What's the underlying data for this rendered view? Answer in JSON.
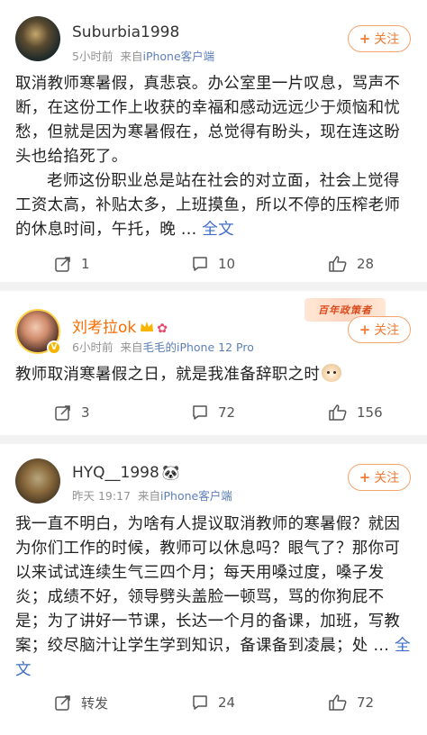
{
  "posts": [
    {
      "username": "Suburbia1998",
      "time": "5小时前",
      "source_prefix": "来自",
      "device": "iPhone客户端",
      "follow_label": "关注",
      "paragraph1": "取消教师寒暑假，真悲哀。办公室里一片叹息，骂声不断，在这份工作上收获的幸福和感动远远少于烦恼和忧愁，但就是因为寒暑假在，总觉得有盼头，现在连这盼头也给掐死了。",
      "paragraph2": "老师这份职业总是站在社会的对立面，社会上觉得工资太高，补贴太多，上班摸鱼，所以不停的压榨老师的休息时间，午托，晚",
      "ellipsis": "...",
      "fulltext_label": "全文",
      "reposts": "1",
      "comments": "10",
      "likes": "28"
    },
    {
      "username": "刘考拉ok",
      "time": "6小时前",
      "source_prefix": "来自",
      "device": "毛毛的iPhone 12 Pro",
      "follow_label": "关注",
      "banner": "百年政策者",
      "text": "教师取消寒暑假之日，就是我准备辞职之时",
      "reposts": "3",
      "comments": "72",
      "likes": "156"
    },
    {
      "username": "HYQ__1998",
      "time": "昨天 19:17",
      "source_prefix": "来自",
      "device": "iPhone客户端",
      "follow_label": "关注",
      "text": "我一直不明白，为啥有人提议取消教师的寒暑假？就因为你们工作的时候，教师可以休息吗？眼气了？那你可以来试试连续生气三四个月；每天用嗓过度，嗓子发炎；成绩不好，领导劈头盖脸一顿骂，骂的你狗屁不是；为了讲好一节课，长达一个月的备课，加班，写教案；绞尽脑汁让学生学到知识，备课备到凌晨；处",
      "ellipsis": "...",
      "fulltext_label": "全文",
      "reposts": "转发",
      "comments": "24",
      "likes": "72"
    }
  ],
  "colors": {
    "accent_orange": "#f07b34",
    "link_blue": "#3f6ec8",
    "vip_name": "#f86c00",
    "separator": "#f2f2f2"
  },
  "icons": {
    "repost": "repost-icon",
    "comment": "comment-icon",
    "like": "thumbs-up-icon"
  }
}
